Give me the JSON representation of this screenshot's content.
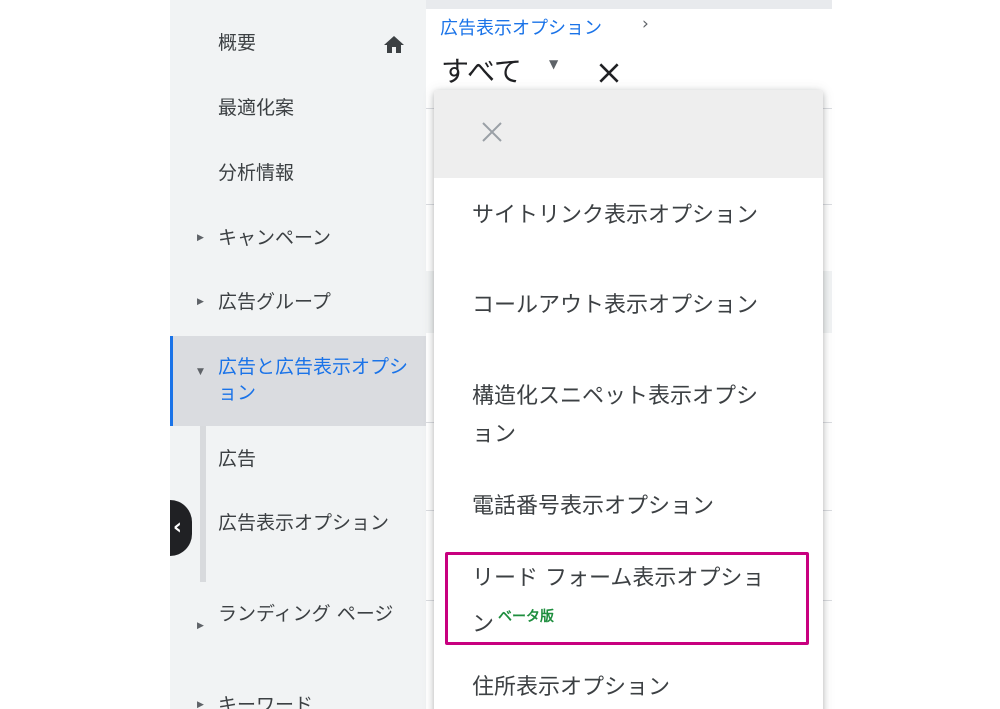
{
  "sidebar": {
    "items": [
      {
        "label": "概要"
      },
      {
        "label": "最適化案"
      },
      {
        "label": "分析情報"
      },
      {
        "label": "キャンペーン"
      },
      {
        "label": "広告グループ"
      },
      {
        "label": "広告と広告表示オプション"
      },
      {
        "label": "広告"
      },
      {
        "label": "広告表示オプション"
      },
      {
        "label": "ランディング ページ"
      },
      {
        "label": "キーワード"
      }
    ],
    "home_icon": "home-icon",
    "collapse_icon": "chevron-left-icon"
  },
  "header": {
    "breadcrumb": "広告表示オプション",
    "breadcrumb_chevron": "›",
    "filter_title": "すべて"
  },
  "dropdown": {
    "close_icon": "close-icon",
    "items": [
      {
        "label": "サイトリンク表示オプション"
      },
      {
        "label": "コールアウト表示オプション"
      },
      {
        "label": "構造化スニペット表示オプション"
      },
      {
        "label": "電話番号表示オプション"
      },
      {
        "label": "リード フォーム表示オプション",
        "badge": "ベータ版"
      },
      {
        "label": "住所表示オプション"
      }
    ]
  },
  "colors": {
    "accent": "#1a73e8",
    "highlight": "#c8007f",
    "beta": "#1e8e3e"
  }
}
